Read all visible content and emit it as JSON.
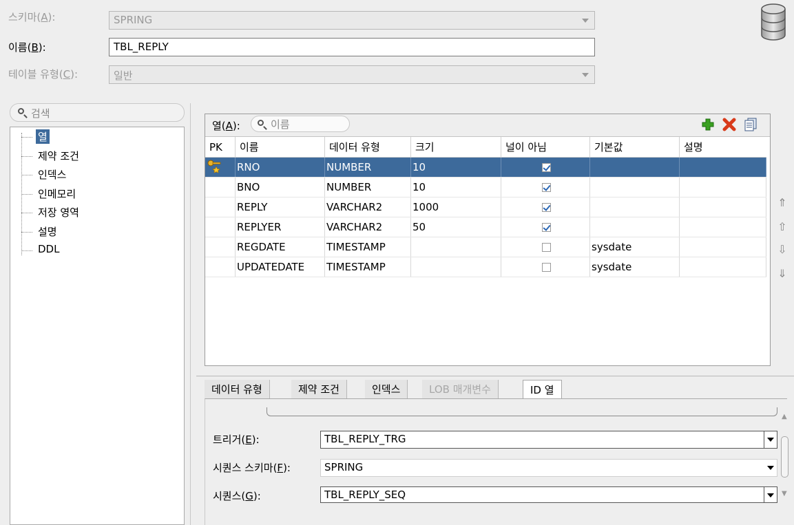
{
  "form": {
    "schema_label_pre": "스키마(",
    "schema_label_key": "A",
    "schema_label_post": "):",
    "schema_value": "SPRING",
    "name_label_pre": "이름(",
    "name_label_key": "B",
    "name_label_post": "):",
    "name_value": "TBL_REPLY",
    "type_label_pre": "테이블 유형(",
    "type_label_key": "C",
    "type_label_post": "):",
    "type_value": "일반",
    "db_icon": "database-icon"
  },
  "nav": {
    "search_placeholder": "검색",
    "items": [
      "열",
      "제약 조건",
      "인덱스",
      "인메모리",
      "저장 영역",
      "설명",
      "DDL"
    ],
    "selected": "열"
  },
  "columns": {
    "label_pre": "열(",
    "label_key": "A",
    "label_post": "):",
    "search_placeholder": "이름",
    "headers": [
      "PK",
      "이름",
      "데이터 유형",
      "크기",
      "널이 아님",
      "기본값",
      "설명"
    ],
    "rows": [
      {
        "pk": true,
        "name": "RNO",
        "type": "NUMBER",
        "size": "10",
        "not_null": true,
        "default": "",
        "desc": ""
      },
      {
        "pk": false,
        "name": "BNO",
        "type": "NUMBER",
        "size": "10",
        "not_null": true,
        "default": "",
        "desc": ""
      },
      {
        "pk": false,
        "name": "REPLY",
        "type": "VARCHAR2",
        "size": "1000",
        "not_null": true,
        "default": "",
        "desc": ""
      },
      {
        "pk": false,
        "name": "REPLYER",
        "type": "VARCHAR2",
        "size": "50",
        "not_null": true,
        "default": "",
        "desc": ""
      },
      {
        "pk": false,
        "name": "REGDATE",
        "type": "TIMESTAMP",
        "size": "",
        "not_null": false,
        "default": "sysdate",
        "desc": ""
      },
      {
        "pk": false,
        "name": "UPDATEDATE",
        "type": "TIMESTAMP",
        "size": "",
        "not_null": false,
        "default": "sysdate",
        "desc": ""
      }
    ],
    "selected_row": 0
  },
  "bottom": {
    "tabs": [
      "데이터 유형",
      "제약 조건",
      "인덱스",
      "LOB 매개변수",
      "ID 열"
    ],
    "active_tab": "ID 열",
    "disabled_tab": "LOB 매개변수",
    "trigger_label_pre": "트리거(",
    "trigger_label_key": "E",
    "trigger_label_post": "):",
    "trigger_value": "TBL_REPLY_TRG",
    "seq_schema_label_pre": "시퀀스 스키마(",
    "seq_schema_label_key": "F",
    "seq_schema_label_post": "):",
    "seq_schema_value": "SPRING",
    "seq_label_pre": "시퀀스(",
    "seq_label_key": "G",
    "seq_label_post": "):",
    "seq_value": "TBL_REPLY_SEQ"
  },
  "colors": {
    "selection": "#3d6a9b",
    "add": "#3aa021",
    "delete": "#d83a1a"
  }
}
